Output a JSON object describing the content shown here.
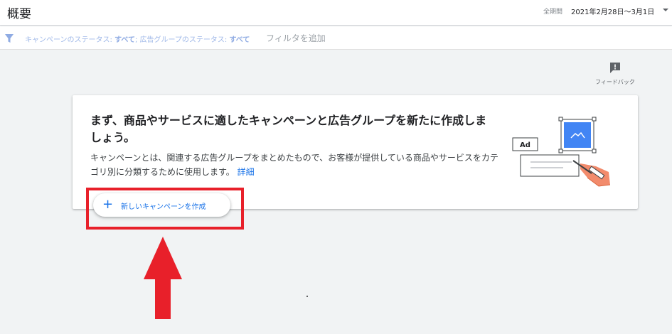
{
  "header": {
    "title": "概要",
    "date_range_label": "全期間",
    "date_range_value": "2021年2月28日〜3月1日"
  },
  "filter_bar": {
    "campaign_status_label": "キャンペーンのステータス: ",
    "campaign_status_value": "すべて",
    "ad_group_status_label": "; 広告グループのステータス: ",
    "ad_group_status_value": "すべて",
    "add_filter": "フィルタを追加"
  },
  "feedback": {
    "label": "フィードバック",
    "icon": "feedback-icon"
  },
  "card": {
    "title": "まず、商品やサービスに適したキャンペーンと広告グループを新たに作成しましょう。",
    "description": "キャンペーンとは、関連する広告グループをまとめたもので、お客様が提供している商品やサービスをカテゴリ別に分類するために使用します。",
    "link": "詳細",
    "illustration_label": "Ad"
  },
  "create_button": {
    "icon": "plus-icon",
    "label": "新しいキャンペーンを作成"
  },
  "colors": {
    "accent": "#1a73e8",
    "annotation_red": "#e8202a"
  }
}
